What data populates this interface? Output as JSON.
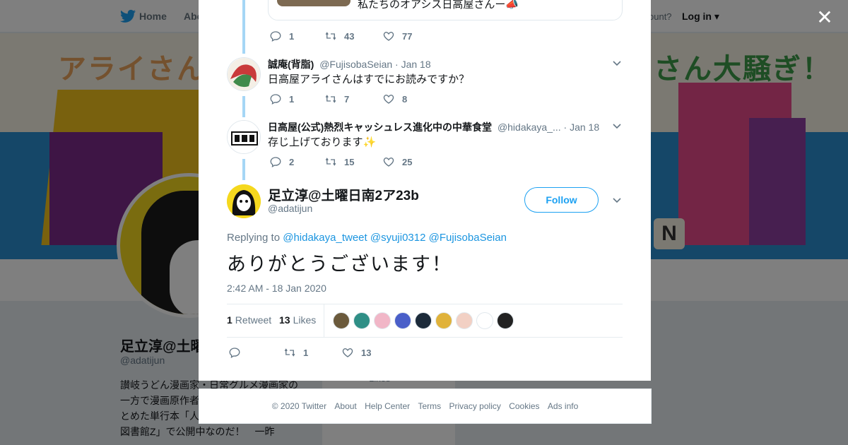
{
  "nav": {
    "home": "Home",
    "about": "Abo",
    "have_account": "ccount?",
    "login": "Log in"
  },
  "banner": {
    "text_left": "アライさん",
    "text_right": "さん大騒ぎ！",
    "badge": "N"
  },
  "profile": {
    "name": "足立淳@土曜",
    "handle": "@adatijun",
    "bio": "讃岐うどん漫画家・日常グルメ漫画家の一方で漫画原作者「毛あさみ」。週刊をまとめた単行本「人間晦八日」は「マンガ図書館Z」で公開中なのだ！　一昨",
    "widget_label": "Likes"
  },
  "modal": {
    "prev_caption": "私たちのオアシス日高屋さんー📣",
    "prev_actions": {
      "reply": "1",
      "retweet": "43",
      "like": "77"
    },
    "replies": [
      {
        "name": "誠庵(背脂)",
        "handle": "@FujisobaSeian",
        "date": "· Jan 18",
        "text": "日高屋アライさんはすでにお読みですか？",
        "reply": "1",
        "retweet": "7",
        "like": "8"
      },
      {
        "name": "日高屋(公式)熱烈キャッシュレス進化中の中華食堂",
        "handle": "@hidakaya_...",
        "date": "· Jan 18",
        "text": "存じ上げております✨",
        "reply": "2",
        "retweet": "15",
        "like": "25"
      }
    ],
    "main": {
      "name": "足立淳@土曜日南2ア23b",
      "handle": "@adatijun",
      "follow": "Follow",
      "replying_label": "Replying to",
      "mentions": [
        "@hidakaya_tweet",
        "@syuji0312",
        "@FujisobaSeian"
      ],
      "text": "ありがとうございます！",
      "timestamp": "2:42 AM - 18 Jan 2020",
      "retweet_count": "1",
      "retweet_label": "Retweet",
      "likes_count": "13",
      "likes_label": "Likes",
      "action_retweet": "1",
      "action_like": "13"
    },
    "liker_colors": [
      "#6b5a3c",
      "#2f8f86",
      "#f1b6c7",
      "#4a5fc9",
      "#1c2b3a",
      "#e0b23a",
      "#f2d0c4",
      "#ffffff",
      "#222222"
    ]
  },
  "footer": {
    "items": [
      "© 2020 Twitter",
      "About",
      "Help Center",
      "Terms",
      "Privacy policy",
      "Cookies",
      "Ads info"
    ]
  },
  "colors": {
    "accent": "#1da1f2",
    "thread_line": "#a5d6f5"
  }
}
